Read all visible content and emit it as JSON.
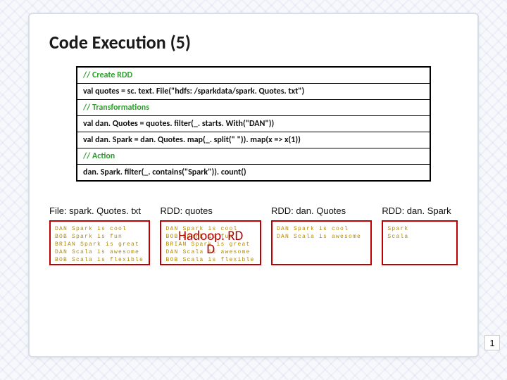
{
  "title": "Code Execution (5)",
  "code": {
    "c1": "// Create RDD",
    "l1": "val quotes = sc. text. File(\"hdfs: /sparkdata/spark. Quotes. txt\")",
    "c2": "// Transformations",
    "l2": "val dan. Quotes = quotes. filter(_. starts. With(\"DAN\"))",
    "l3": "val dan. Spark = dan. Quotes. map(_. split(\" \")). map(x => x(1))",
    "c3": "// Action",
    "l4": "dan. Spark. filter(_. contains(\"Spark\")). count()"
  },
  "rdds": [
    {
      "label": "File: spark. Quotes. txt",
      "lines": "DAN Spark is cool\nBOB Spark is fun\nBRIAN Spark is great\nDAN Scala is awesome\nBOB Scala is flexible"
    },
    {
      "label": "RDD: quotes",
      "lines": "DAN Spark is cool\nBOB Spark is fun\nBRIAN Spark is great\nDAN Scala is awesome\nBOB Scala is flexible",
      "overlay1": "Hadoop. RD",
      "overlay2": "D"
    },
    {
      "label": "RDD: dan. Quotes",
      "lines": "DAN Spark is cool\nDAN Scala is awesome"
    },
    {
      "label": "RDD: dan. Spark",
      "lines": "Spark\nScala"
    }
  ],
  "page": "1"
}
